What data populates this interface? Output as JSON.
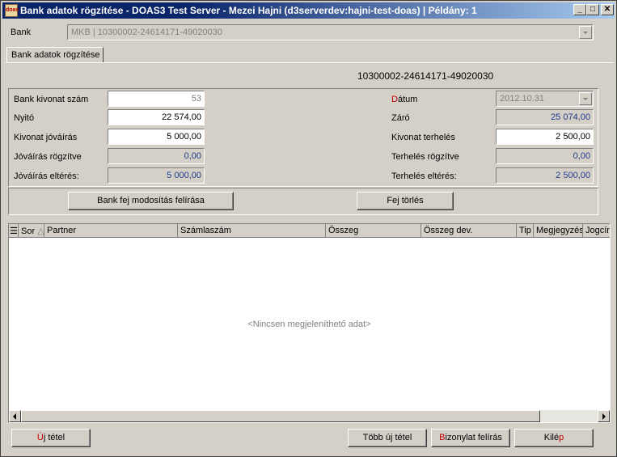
{
  "window": {
    "title": "Bank adatok rögzítése - DOAS3 Test Server - Mezei Hajni (d3serverdev:hajni-test-doas) | Példány: 1",
    "app_icon_text": "doas",
    "minimize_glyph": "_",
    "maximize_glyph": "□",
    "close_glyph": "✕"
  },
  "bank": {
    "label": "Bank",
    "value": "MKB | 10300002-24614171-49020030"
  },
  "tab": {
    "label": "Bank adatok rögzítése"
  },
  "account_number": "10300002-24614171-49020030",
  "left_fields": {
    "kivonat_szam": {
      "label": "Bank kivonat szám",
      "value": "53"
    },
    "nyito": {
      "label": "Nyitó",
      "value": "22 574,00"
    },
    "kivonat_jovairas": {
      "label": "Kivonat jóváírás",
      "value": "5 000,00"
    },
    "jovairas_rogzitve": {
      "label": "Jóváírás rögzítve",
      "value": "0,00"
    },
    "jovairas_elteres": {
      "label": "Jóváírás eltérés:",
      "value": "5 000,00"
    }
  },
  "right_fields": {
    "datum": {
      "label_first": "D",
      "label_rest": "átum",
      "value": "2012.10.31"
    },
    "zaro": {
      "label": "Záró",
      "value": "25 074,00"
    },
    "kivonat_terheles": {
      "label": "Kivonat terhelés",
      "value": "2 500,00"
    },
    "terheles_rogzitve": {
      "label": "Terhelés rögzítve",
      "value": "0,00"
    },
    "terheles_elteres": {
      "label": "Terhelés eltérés:",
      "value": "2 500,00"
    }
  },
  "actions": {
    "bank_fej": "Bank fej modosítás felírása",
    "fej_torles": "Fej törlés"
  },
  "grid": {
    "columns": [
      "Sor",
      "Partner",
      "Számlaszám",
      "Összeg",
      "Összeg dev.",
      "Tip",
      "Megjegyzés",
      "Jogcím"
    ],
    "empty_message": "<Nincsen megjeleníthető adat>"
  },
  "footer": {
    "uj_tetel_first": "Ú",
    "uj_tetel_rest": "j tétel",
    "tobb_uj_tetel": "Több új tétel",
    "bizonylat_first": "B",
    "bizonylat_rest": "izonylat felírás",
    "kilep_first": "Kilé",
    "kilep_last": "p"
  }
}
